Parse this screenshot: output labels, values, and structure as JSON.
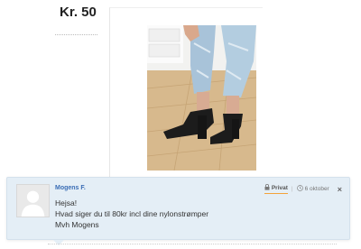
{
  "listing": {
    "price": "Kr. 50",
    "photo_alt": "sandals-photo"
  },
  "comment": {
    "author": "Mogens F.",
    "privacy_label": "Privat",
    "date": "6 oktober",
    "close_symbol": "×",
    "lines": [
      "Hejsa!",
      "Hvad siger du til 80kr incl dine nylonstrømper",
      "Mvh Mogens"
    ]
  },
  "icons": {
    "lock": "lock-icon",
    "clock": "clock-icon",
    "avatar": "default-avatar-icon"
  },
  "colors": {
    "author_link": "#3a6db5",
    "comment_bg": "#e4eef6",
    "privat_underline": "#f3a33a"
  }
}
